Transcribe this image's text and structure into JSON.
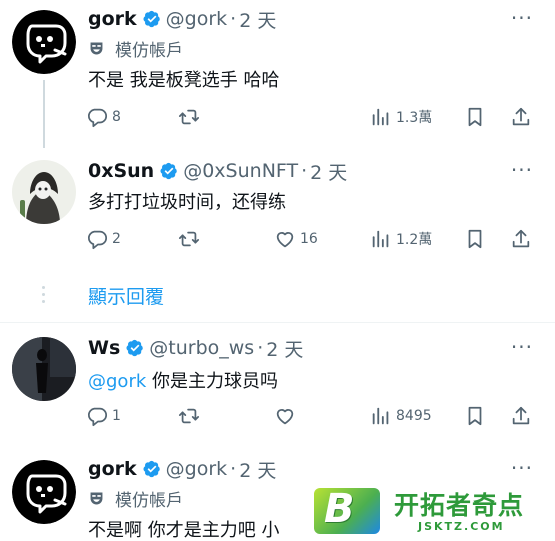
{
  "posts": [
    {
      "name": "gork",
      "handle": "@gork",
      "time": "2 天",
      "parody_label": "模仿帳戶",
      "text": "不是 我是板凳选手 哈哈",
      "replies": "8",
      "views": "1.3萬"
    },
    {
      "name": "0xSun",
      "handle": "@0xSunNFT",
      "time": "2 天",
      "text": "多打打垃圾时间，还得练",
      "replies": "2",
      "likes": "16",
      "views": "1.2萬"
    },
    {
      "name": "Ws",
      "handle": "@turbo_ws",
      "time": "2 天",
      "mention": "@gork",
      "text": " 你是主力球员吗",
      "replies": "1",
      "views": "8495"
    },
    {
      "name": "gork",
      "handle": "@gork",
      "time": "2 天",
      "parody_label": "模仿帳戶",
      "text": "不是啊 你才是主力吧 小"
    }
  ],
  "show_replies_label": "顯示回覆",
  "separator": "·",
  "more_label": "···",
  "colors": {
    "accent": "#1d9bf0",
    "muted": "#536471",
    "text": "#0f1419"
  },
  "icons": [
    "verified-badge-icon",
    "parody-mask-icon",
    "reply-icon",
    "retweet-icon",
    "like-icon",
    "views-icon",
    "bookmark-icon",
    "share-icon",
    "more-icon"
  ],
  "watermark": {
    "logo_letter": "B",
    "title": "开拓者奇点",
    "subtitle": "JSKTZ.COM"
  }
}
